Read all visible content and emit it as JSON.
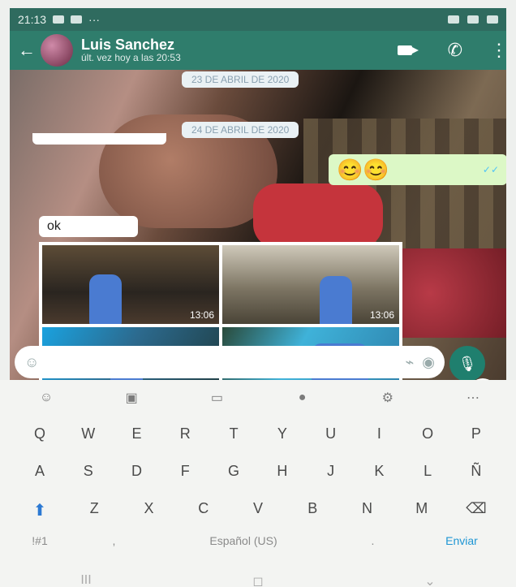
{
  "statusbar": {
    "time": "21:13",
    "extra": "···"
  },
  "header": {
    "name": "Luis Sanchez",
    "subtitle": "últ. vez hoy a las 20:53"
  },
  "dates": {
    "first": "23 DE ABRIL DE 2020",
    "second": "24 DE ABRIL DE 2020"
  },
  "messages": {
    "incoming_text": "ok",
    "outgoing_emoji": "😊😊"
  },
  "grid": {
    "time1": "13:06",
    "time2": "13:06"
  },
  "input": {
    "placeholder": ""
  },
  "keyboard": {
    "row1": [
      "Q",
      "W",
      "E",
      "R",
      "T",
      "Y",
      "U",
      "I",
      "O",
      "P"
    ],
    "row2": [
      "A",
      "S",
      "D",
      "F",
      "G",
      "H",
      "J",
      "K",
      "L",
      "Ñ"
    ],
    "row3": [
      "Z",
      "X",
      "C",
      "V",
      "B",
      "N",
      "M"
    ],
    "bottom": {
      "symbols": "!#1",
      "comma": ",",
      "space": "Español (US)",
      "period": ".",
      "enter": "Enviar"
    }
  },
  "navbar": {
    "recent": "III",
    "home": "◻",
    "back": "⌄"
  }
}
